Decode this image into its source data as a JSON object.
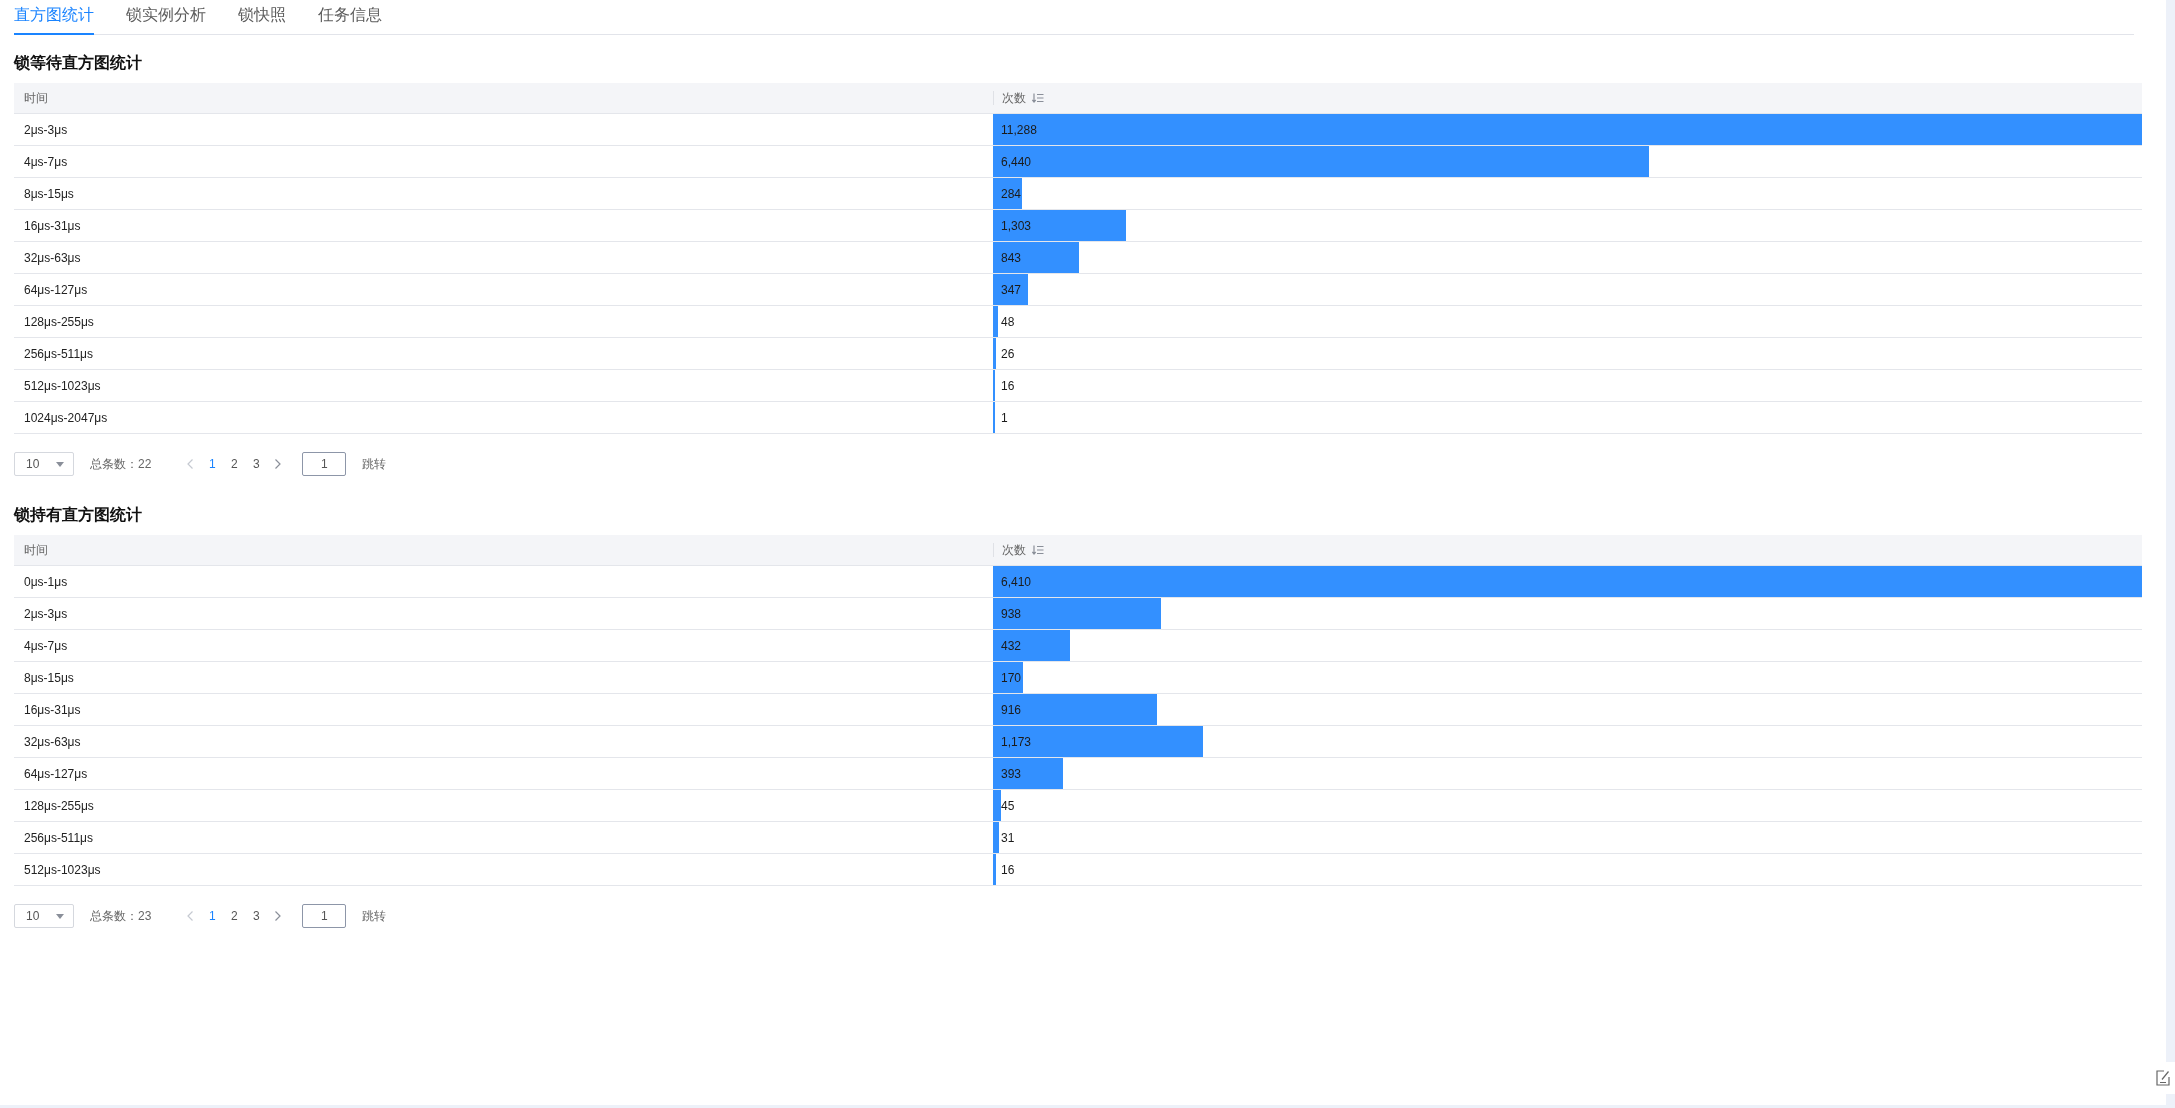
{
  "tabs": [
    {
      "label": "直方图统计",
      "selected": true
    },
    {
      "label": "锁实例分析",
      "selected": false
    },
    {
      "label": "锁快照",
      "selected": false
    },
    {
      "label": "任务信息",
      "selected": false
    }
  ],
  "sections": [
    {
      "title": "锁等待直方图统计",
      "table": {
        "columns": [
          {
            "label": "时间",
            "sortable": false
          },
          {
            "label": "次数",
            "sortable": true
          }
        ],
        "rows": [
          {
            "time": "2μs-3μs",
            "count": "11,288",
            "level": 1
          },
          {
            "time": "4μs-7μs",
            "count": "6,440",
            "level": 0.5705
          },
          {
            "time": "8μs-15μs",
            "count": "284",
            "level": 0.0252
          },
          {
            "time": "16μs-31μs",
            "count": "1,303",
            "level": 0.1154
          },
          {
            "time": "32μs-63μs",
            "count": "843",
            "level": 0.0747
          },
          {
            "time": "64μs-127μs",
            "count": "347",
            "level": 0.0307
          },
          {
            "time": "128μs-255μs",
            "count": "48",
            "level": 0.0043
          },
          {
            "time": "256μs-511μs",
            "count": "26",
            "level": 0.0023
          },
          {
            "time": "512μs-1023μs",
            "count": "16",
            "level": 0.0014
          },
          {
            "time": "1024μs-2047μs",
            "count": "1",
            "level": 0.0001
          }
        ]
      },
      "pagination": {
        "page_size": "10",
        "total": "总条数：22",
        "prev": {
          "disabled": true
        },
        "pages": [
          {
            "label": "1",
            "selected": true
          },
          {
            "label": "2",
            "selected": false
          },
          {
            "label": "3",
            "selected": false
          }
        ],
        "next": {
          "disabled": false
        },
        "jump_value": "1",
        "jump_label": "跳转"
      }
    },
    {
      "title": "锁持有直方图统计",
      "table": {
        "columns": [
          {
            "label": "时间",
            "sortable": false
          },
          {
            "label": "次数",
            "sortable": true
          }
        ],
        "rows": [
          {
            "time": "0μs-1μs",
            "count": "6,410",
            "level": 1
          },
          {
            "time": "2μs-3μs",
            "count": "938",
            "level": 0.1463
          },
          {
            "time": "4μs-7μs",
            "count": "432",
            "level": 0.0674
          },
          {
            "time": "8μs-15μs",
            "count": "170",
            "level": 0.0265
          },
          {
            "time": "16μs-31μs",
            "count": "916",
            "level": 0.1429
          },
          {
            "time": "32μs-63μs",
            "count": "1,173",
            "level": 0.183
          },
          {
            "time": "64μs-127μs",
            "count": "393",
            "level": 0.0613
          },
          {
            "time": "128μs-255μs",
            "count": "45",
            "level": 0.007
          },
          {
            "time": "256μs-511μs",
            "count": "31",
            "level": 0.0048
          },
          {
            "time": "512μs-1023μs",
            "count": "16",
            "level": 0.0025
          }
        ]
      },
      "pagination": {
        "page_size": "10",
        "total": "总条数：23",
        "prev": {
          "disabled": true
        },
        "pages": [
          {
            "label": "1",
            "selected": true
          },
          {
            "label": "2",
            "selected": false
          },
          {
            "label": "3",
            "selected": false
          }
        ],
        "next": {
          "disabled": false
        },
        "jump_value": "1",
        "jump_label": "跳转"
      }
    }
  ]
}
